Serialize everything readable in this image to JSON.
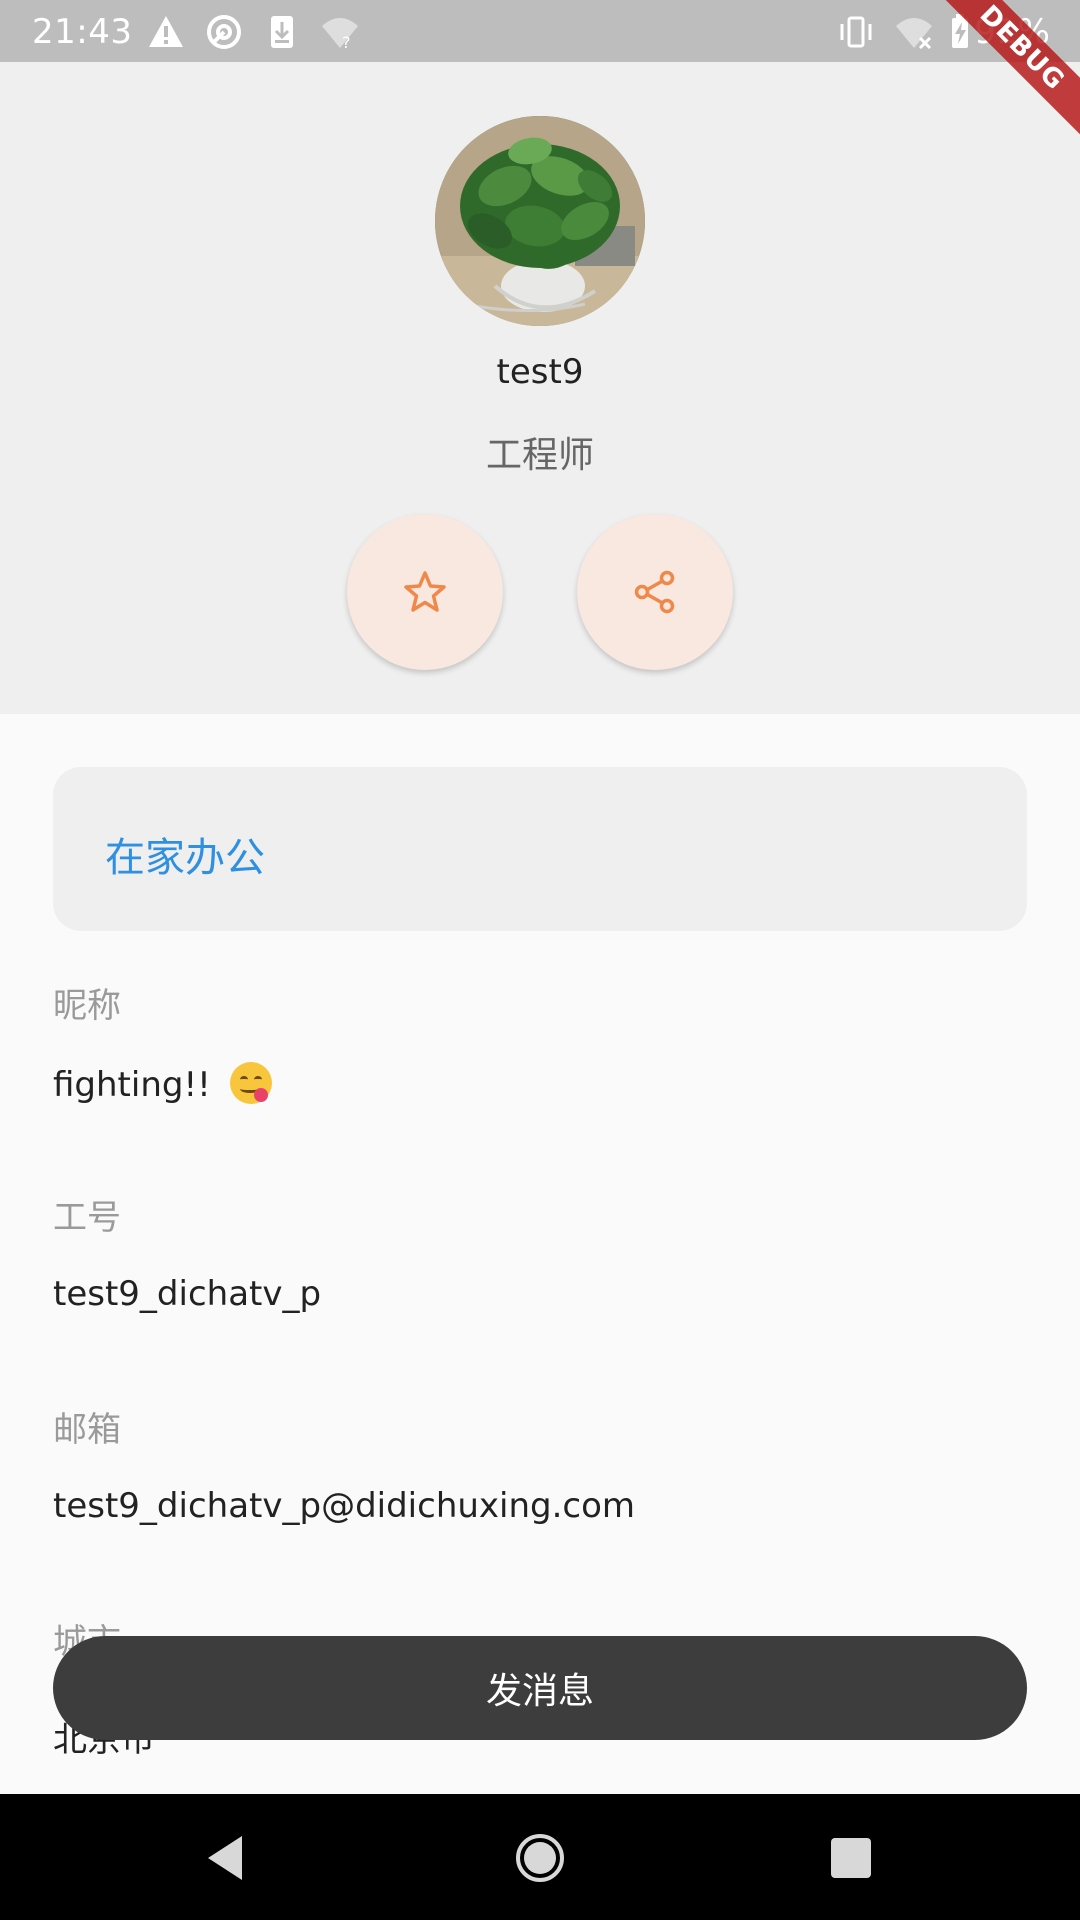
{
  "status_bar": {
    "time": "21:43",
    "battery": "91%",
    "icons": [
      "alert-icon",
      "sync-icon",
      "download-icon",
      "wifi-question-icon",
      "vibrate-icon",
      "wifi-off-icon",
      "battery-charging-icon"
    ]
  },
  "debug_banner": {
    "label": "DEBUG"
  },
  "profile": {
    "name": "test9",
    "title": "工程师"
  },
  "actions": {
    "favorite_icon": "star-icon",
    "share_icon": "share-icon"
  },
  "status_card": {
    "text": "在家办公"
  },
  "fields": [
    {
      "label": "昵称",
      "value": "fighting!! "
    },
    {
      "label": "工号",
      "value": "test9_dichatv_p"
    },
    {
      "label": "邮箱",
      "value": "test9_dichatv_p@didichuxing.com"
    },
    {
      "label": "城市",
      "value": "北京市"
    }
  ],
  "send_button": {
    "label": "发消息"
  },
  "colors": {
    "accent_blue": "#2f8fe0",
    "icon_orange": "#f0884a",
    "button_dark": "#3d3d3d",
    "action_bg": "#f9e8e0"
  },
  "nav": {
    "icons": [
      "back-icon",
      "home-icon",
      "recents-icon"
    ]
  }
}
